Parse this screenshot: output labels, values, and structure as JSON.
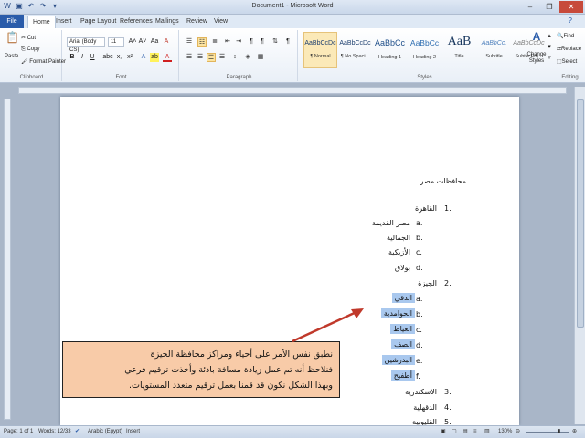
{
  "window": {
    "title": "Document1 - Microsoft Word",
    "controls": [
      "–",
      "❐",
      "✕"
    ]
  },
  "tabs": [
    "File",
    "Home",
    "Insert",
    "Page Layout",
    "References",
    "Mailings",
    "Review",
    "View"
  ],
  "clipboard": {
    "paste": "Paste",
    "cut": "Cut",
    "copy": "Copy",
    "format_painter": "Format Painter",
    "label": "Clipboard"
  },
  "font": {
    "name": "Arial (Body CS)",
    "size": "11",
    "label": "Font",
    "grow": "A˄",
    "shrink": "A˅",
    "case": "Aa",
    "clear": "A",
    "bold": "B",
    "italic": "I",
    "underline": "U",
    "strike": "abc",
    "sub": "x₂",
    "sup": "x²",
    "effects": "A",
    "highlight": "ab",
    "color": "A"
  },
  "paragraph": {
    "label": "Paragraph"
  },
  "styles": {
    "label": "Styles",
    "items": [
      {
        "preview": "AaBbCcDc",
        "name": "¶ Normal"
      },
      {
        "preview": "AaBbCcDc",
        "name": "¶ No Spaci..."
      },
      {
        "preview": "AaBbCc",
        "name": "Heading 1"
      },
      {
        "preview": "AaBbCc",
        "name": "Heading 2"
      },
      {
        "preview": "AaB",
        "name": "Title"
      },
      {
        "preview": "AaBbCc.",
        "name": "Subtitle"
      },
      {
        "preview": "AaBbCcDc",
        "name": "Subtle Em..."
      }
    ],
    "change_styles": "Change Styles"
  },
  "editing": {
    "label": "Editing",
    "find": "Find",
    "replace": "Replace",
    "select": "Select"
  },
  "document": {
    "heading": "محافظات مصر",
    "list": [
      {
        "num": "1.",
        "text": "القاهرة"
      },
      {
        "num": "a.",
        "text": "مصر القديمة"
      },
      {
        "num": "b.",
        "text": "الجمالية"
      },
      {
        "num": "c.",
        "text": "الأزبكية"
      },
      {
        "num": "d.",
        "text": "بولاق"
      },
      {
        "num": "2.",
        "text": "الجيزة"
      },
      {
        "num": "a.",
        "text": "الدقي"
      },
      {
        "num": "b.",
        "text": "الحوامدية"
      },
      {
        "num": "c.",
        "text": "العياط"
      },
      {
        "num": "d.",
        "text": "الصف"
      },
      {
        "num": "e.",
        "text": "البدرشين"
      },
      {
        "num": "f.",
        "text": "أطفيح"
      },
      {
        "num": "3.",
        "text": "الاسكندرية"
      },
      {
        "num": "4.",
        "text": "الدقهلية"
      },
      {
        "num": "5.",
        "text": "القليوبية"
      }
    ]
  },
  "callout": {
    "lines": [
      "نطبق نفس الأمر على أحياء ومراكز محافظة الجيزة",
      "فنلاحظ أنه تم عمل زيادة مسافة بادئة وأخذت ترقيم فرعي",
      "وبهذا الشكل نكون قد قمنا بعمل ترقيم متعدد المستويات."
    ]
  },
  "status": {
    "page": "Page: 1 of 1",
    "words": "Words: 12/33",
    "language": "Arabic (Egypt)",
    "mode": "Insert",
    "zoom": "130%"
  },
  "colors": {
    "accent": "#2a5caa",
    "highlight": "#a9c8ee",
    "callout": "#f8cba8",
    "arrow": "#c0392b"
  }
}
